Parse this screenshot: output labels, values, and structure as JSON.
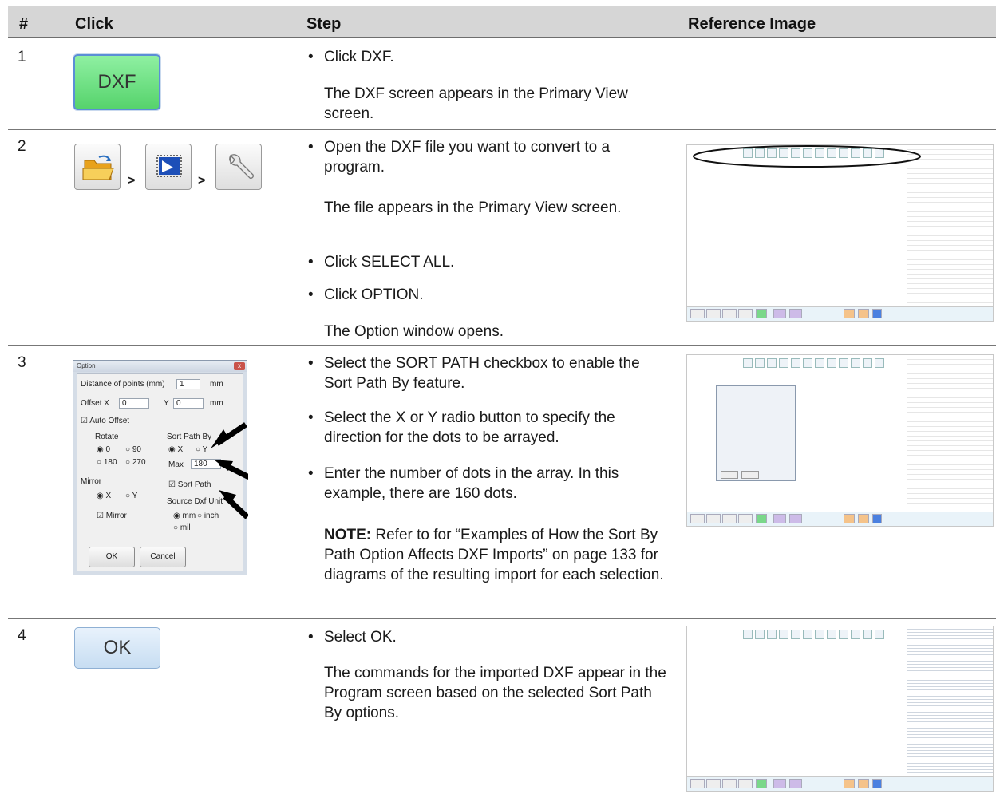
{
  "header": {
    "col_num": "#",
    "col_click": "Click",
    "col_step": "Step",
    "col_ref": "Reference Image"
  },
  "rows": [
    {
      "num": "1",
      "button_label": "DXF",
      "bullets": [
        "Click DXF."
      ],
      "paras": [
        "The DXF screen appears in the Primary View screen."
      ]
    },
    {
      "num": "2",
      "separators": [
        ">",
        ">"
      ],
      "icons": [
        "open-folder-icon",
        "select-all-icon",
        "wrench-icon"
      ],
      "bullets": [
        "Open the DXF file you want to convert to a program.",
        "Click SELECT ALL.",
        "Click OPTION."
      ],
      "paras": [
        "The file appears in the Primary View screen.",
        "The Option window opens."
      ]
    },
    {
      "num": "3",
      "bullets": [
        "Select the SORT PATH checkbox to enable the Sort Path By feature.",
        "Select the X or Y radio button to specify the direction for the dots to be arrayed.",
        "Enter the number of dots in the array. In this example, there are 160 dots."
      ],
      "note_label": "NOTE:",
      "note_text": " Refer to for “Examples of How the Sort By Path Option Affects DXF Imports” on page 133 for diagrams of the resulting import for each selection."
    },
    {
      "num": "4",
      "button_label": "OK",
      "bullets": [
        "Select OK."
      ],
      "paras": [
        "The commands for the imported DXF appear in the Program screen based on the selected Sort Path By options."
      ]
    }
  ],
  "option_dialog": {
    "title": "Option",
    "close": "x",
    "distance_label": "Distance of points (mm)",
    "distance_value": "1",
    "unit_mm": "mm",
    "offset_x_label": "Offset X",
    "offset_x_value": "0",
    "offset_y_label": "Y",
    "offset_y_value": "0",
    "auto_offset": "Auto Offset",
    "rotate_label": "Rotate",
    "rotate_options": [
      "0",
      "90",
      "180",
      "270"
    ],
    "sort_path_by_label": "Sort Path By",
    "sort_x": "X",
    "sort_y": "Y",
    "max_label": "Max",
    "max_value": "180",
    "mirror_label": "Mirror",
    "mirror_x": "X",
    "mirror_y": "Y",
    "mirror_check": "Mirror",
    "sort_path_check": "Sort Path",
    "source_unit_label": "Source Dxf Unit",
    "unit_options": [
      "mm",
      "inch",
      "mil"
    ],
    "ok": "OK",
    "cancel": "Cancel"
  }
}
